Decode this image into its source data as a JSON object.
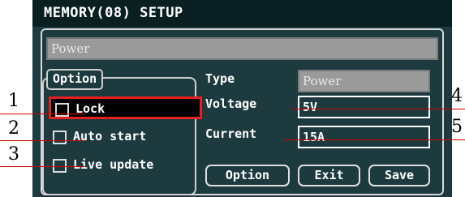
{
  "header": {
    "title": "MEMORY(08) SETUP"
  },
  "memory_name": {
    "value": "Power"
  },
  "option_group": {
    "legend": "Option",
    "items": [
      {
        "label": "Lock",
        "checked": false,
        "focused": true
      },
      {
        "label": "Auto start",
        "checked": false,
        "focused": false
      },
      {
        "label": "Live update",
        "checked": false,
        "focused": false
      }
    ]
  },
  "settings": {
    "type": {
      "label": "Type",
      "value": "Power"
    },
    "voltage": {
      "label": "Voltage",
      "value": "5V"
    },
    "current": {
      "label": "Current",
      "value": "15A"
    }
  },
  "buttons": {
    "option": "Option",
    "exit": "Exit",
    "save": "Save"
  },
  "callouts": [
    "1",
    "2",
    "3",
    "4",
    "5"
  ],
  "colors": {
    "screen_bg": "#1d3a3e",
    "titlebar_bg": "#0a1f22",
    "focus_border": "#e52020",
    "callout_line": "#d40000",
    "disabled_field": "#9a9a9a"
  }
}
